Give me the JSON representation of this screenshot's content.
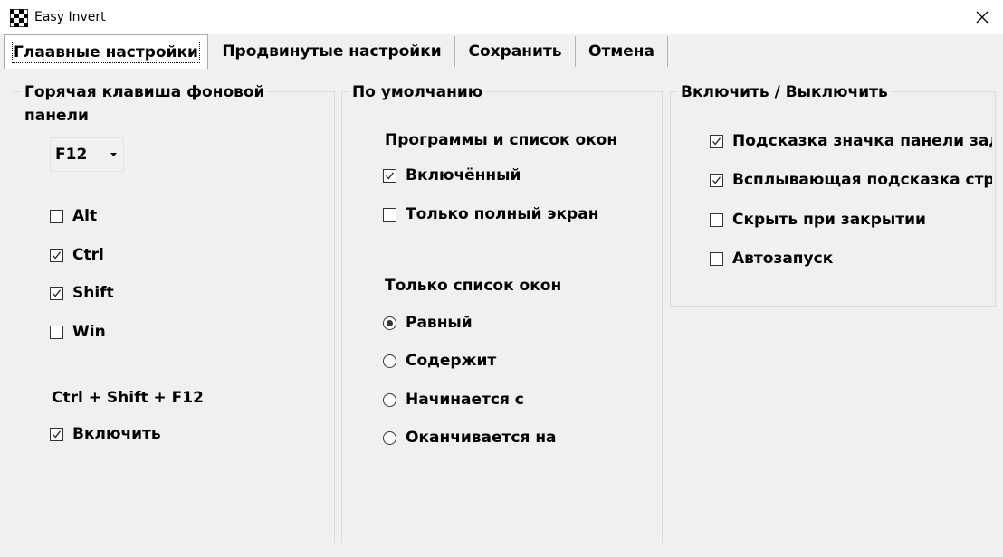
{
  "window": {
    "title": "Easy Invert"
  },
  "tabs": [
    {
      "label": "Глаавные настройки",
      "active": true
    },
    {
      "label": "Продвинутые настройки",
      "active": false
    },
    {
      "label": "Сохранить",
      "active": false
    },
    {
      "label": "Отмена",
      "active": false
    }
  ],
  "hotkey": {
    "title": "Горячая клавиша фоновой\nпанели",
    "key_value": "F12",
    "modifiers": [
      {
        "label": "Alt",
        "checked": false
      },
      {
        "label": "Ctrl",
        "checked": true
      },
      {
        "label": "Shift",
        "checked": true
      },
      {
        "label": "Win",
        "checked": false
      }
    ],
    "combo_text": "Ctrl + Shift + F12",
    "enable": {
      "label": "Включить",
      "checked": true
    }
  },
  "defaults": {
    "title": "По умолчанию",
    "programs_label": "Программы и список окон",
    "enabled": {
      "label": "Включённый",
      "checked": true
    },
    "fullscreen": {
      "label": "Только полный экран",
      "checked": false
    },
    "windows_label": "Только список окон",
    "match_options": [
      {
        "label": "Равный",
        "selected": true
      },
      {
        "label": "Содержит",
        "selected": false
      },
      {
        "label": "Начинается с",
        "selected": false
      },
      {
        "label": "Оканчивается на",
        "selected": false
      }
    ]
  },
  "toggles": {
    "title": "Включить / Выключить",
    "items": [
      {
        "label": "Подсказка значка панели задач",
        "checked": true
      },
      {
        "label": "Всплывающая подсказка строки",
        "checked": true
      },
      {
        "label": "Скрыть при закрытии",
        "checked": false
      },
      {
        "label": "Автозапуск",
        "checked": false
      }
    ]
  }
}
